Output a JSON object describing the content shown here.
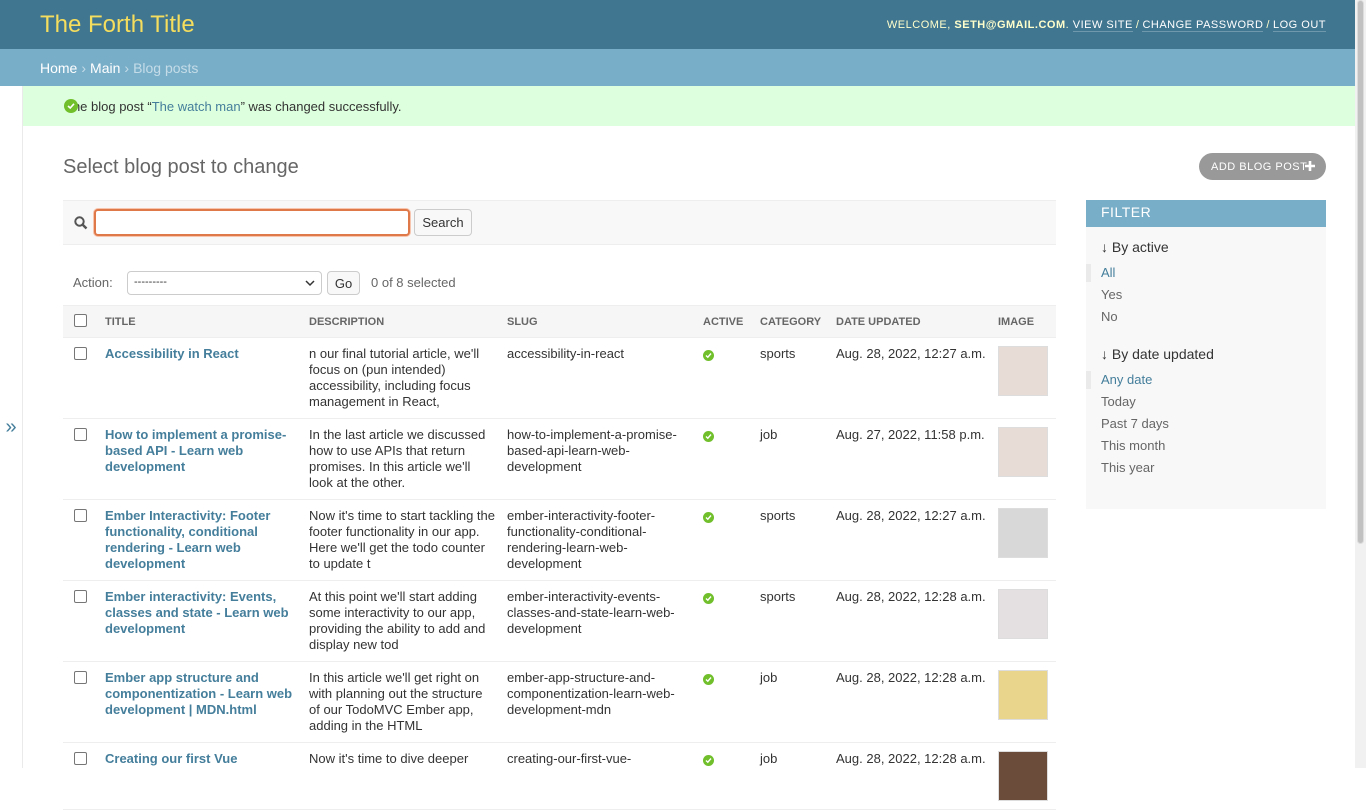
{
  "header": {
    "site_title": "The Forth Title",
    "welcome": "WELCOME,",
    "user": "SETH@GMAIL.COM",
    "view_site": "VIEW SITE",
    "change_password": "CHANGE PASSWORD",
    "log_out": "LOG OUT",
    "separator": "/"
  },
  "breadcrumbs": {
    "home": "Home",
    "main": "Main",
    "current": "Blog posts",
    "arrow": "›"
  },
  "sidebar_toggle": "»",
  "message": {
    "prefix": "The blog post “",
    "link": "The watch man",
    "suffix": "” was changed successfully."
  },
  "page_title": "Select blog post to change",
  "add_button": "ADD BLOG POST",
  "search": {
    "value": "",
    "button": "Search"
  },
  "actions": {
    "label": "Action:",
    "selected": "---------",
    "go": "Go",
    "counter": "0 of 8 selected"
  },
  "table": {
    "headers": [
      "TITLE",
      "DESCRIPTION",
      "SLUG",
      "ACTIVE",
      "CATEGORY",
      "DATE UPDATED",
      "IMAGE"
    ],
    "rows": [
      {
        "title": "Accessibility in React",
        "description": "n our final tutorial article, we'll focus on (pun intended) accessibility, including focus management in React,",
        "slug": "accessibility-in-react",
        "category": "sports",
        "date": "Aug. 28, 2022, 12:27 a.m.",
        "image_color": "#e8dcd6"
      },
      {
        "title": "How to implement a promise-based API - Learn web development",
        "description": "In the last article we discussed how to use APIs that return promises. In this article we'll look at the other.",
        "slug": "how-to-implement-a-promise-based-api-learn-web-development",
        "category": "job",
        "date": "Aug. 27, 2022, 11:58 p.m.",
        "image_color": "#e8dcd6"
      },
      {
        "title": "Ember Interactivity: Footer functionality, conditional rendering - Learn web development",
        "description": "Now it's time to start tackling the footer functionality in our app. Here we'll get the todo counter to update t",
        "slug": "ember-interactivity-footer-functionality-conditional-rendering-learn-web-development",
        "category": "sports",
        "date": "Aug. 28, 2022, 12:27 a.m.",
        "image_color": "#d8d8d8"
      },
      {
        "title": "Ember interactivity: Events, classes and state - Learn web development",
        "description": "At this point we'll start adding some interactivity to our app, providing the ability to add and display new tod",
        "slug": "ember-interactivity-events-classes-and-state-learn-web-development",
        "category": "sports",
        "date": "Aug. 28, 2022, 12:28 a.m.",
        "image_color": "#e4dfe0"
      },
      {
        "title": "Ember app structure and componentization - Learn web development | MDN.html",
        "description": "In this article we'll get right on with planning out the structure of our TodoMVC Ember app, adding in the HTML",
        "slug": "ember-app-structure-and-componentization-learn-web-development-mdn",
        "category": "job",
        "date": "Aug. 28, 2022, 12:28 a.m.",
        "image_color": "#e9d58c"
      },
      {
        "title": "Creating our first Vue",
        "description": "Now it's time to dive deeper",
        "slug": "creating-our-first-vue-",
        "category": "job",
        "date": "Aug. 28, 2022, 12:28 a.m.",
        "image_color": "#6b4c3b"
      }
    ]
  },
  "filter": {
    "title": "FILTER",
    "by_active": {
      "heading": "↓ By active",
      "options": [
        "All",
        "Yes",
        "No"
      ]
    },
    "by_date": {
      "heading": "↓ By date updated",
      "options": [
        "Any date",
        "Today",
        "Past 7 days",
        "This month",
        "This year"
      ]
    }
  },
  "colors": {
    "header_bg": "#417690",
    "branding": "#f5dd5d",
    "breadcrumbs_bg": "#79aec8",
    "link": "#447e9b",
    "success_bg": "#dfd",
    "active_icon": "#70bf2b"
  }
}
